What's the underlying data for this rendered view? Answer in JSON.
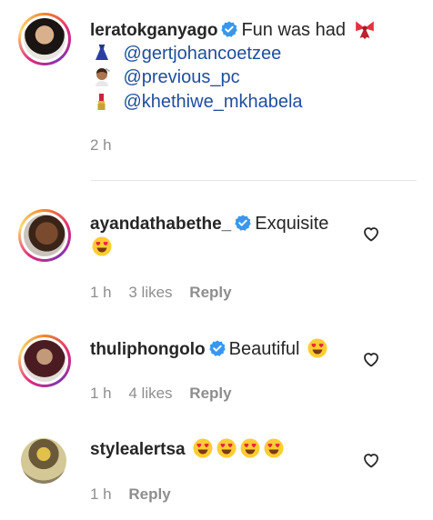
{
  "caption": {
    "username": "leratokganyago",
    "text": "Fun was had",
    "emoji": "ribbon",
    "tags": [
      {
        "emoji": "dress",
        "handle": "@gertjohancoetzee"
      },
      {
        "emoji": "haircut",
        "handle": "@previous_pc"
      },
      {
        "emoji": "lipstick",
        "handle": "@khethiwe_mkhabela"
      }
    ],
    "time": "2 h"
  },
  "comments": [
    {
      "username": "ayandathabethe_",
      "verified": true,
      "text": "Exquisite",
      "emoji": "heart-eyes",
      "time": "1 h",
      "likes": "3 likes",
      "reply": "Reply"
    },
    {
      "username": "thuliphongolo",
      "verified": true,
      "text": "Beautiful",
      "emoji": "heart-eyes",
      "time": "1 h",
      "likes": "4 likes",
      "reply": "Reply"
    },
    {
      "username": "stylealertsa",
      "verified": false,
      "text": "",
      "emoji": "heart-eyes x4",
      "time": "1 h",
      "reply": "Reply"
    }
  ],
  "icons": {
    "verified": "verified-badge-icon",
    "like": "heart-outline-icon"
  },
  "colors": {
    "verified": "#3897f0",
    "mention": "#1f4e9e",
    "meta": "#8e8e8e"
  }
}
